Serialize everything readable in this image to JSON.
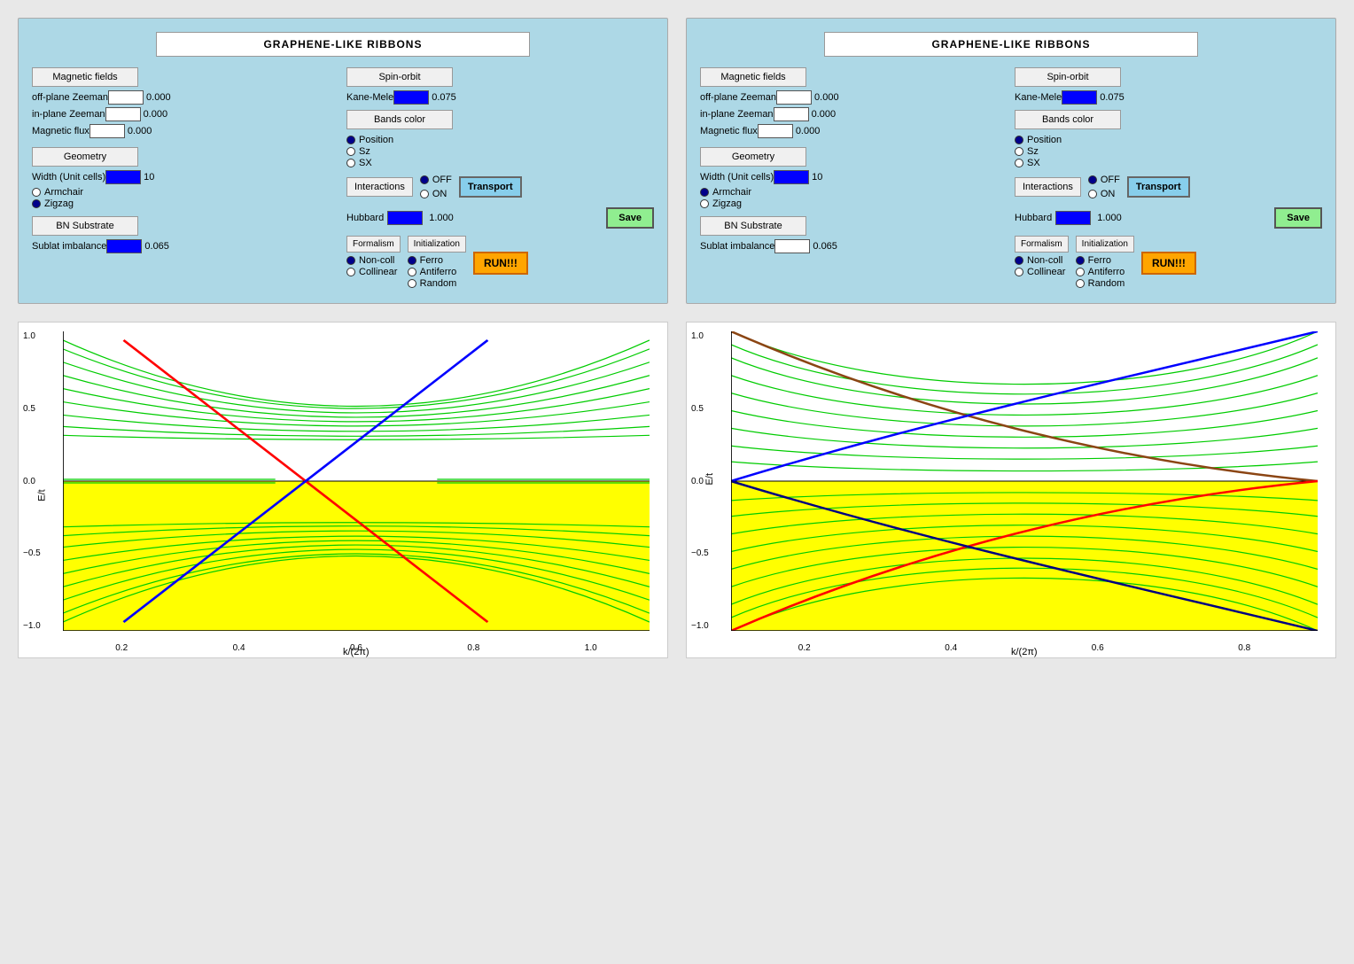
{
  "panels": [
    {
      "id": "panel-left",
      "title": "GRAPHENE-LIKE RIBBONS",
      "magnetic_fields": {
        "label": "Magnetic fields",
        "off_plane_zeeman": {
          "label": "off-plane Zeeman",
          "value": "0.000"
        },
        "in_plane_zeeman": {
          "label": "in-plane Zeeman",
          "value": "0.000"
        },
        "magnetic_flux": {
          "label": "Magnetic flux",
          "value": "0.000"
        }
      },
      "spin_orbit": {
        "label": "Spin-orbit",
        "kane_mele": {
          "label": "Kane-Mele",
          "value": "0.075"
        }
      },
      "bands_color": {
        "label": "Bands color",
        "options": [
          "Position",
          "Sz",
          "SX"
        ],
        "selected": "Position"
      },
      "geometry": {
        "label": "Geometry",
        "width_label": "Width (Unit cells)",
        "width_value": "10",
        "edge_options": [
          "Armchair",
          "Zigzag"
        ],
        "edge_selected": "Zigzag"
      },
      "interactions": {
        "label": "Interactions",
        "off_label": "OFF",
        "on_label": "ON",
        "selected": "OFF",
        "hubbard_label": "Hubbard",
        "hubbard_value": "1.000"
      },
      "bn_substrate": {
        "label": "BN Substrate",
        "sublat_label": "Sublat imbalance",
        "sublat_value": "0.065"
      },
      "formalism": {
        "label": "Formalism",
        "options": [
          "Non-coll",
          "Collinear"
        ],
        "selected": "Non-coll"
      },
      "initialization": {
        "label": "Initialization",
        "options": [
          "Ferro",
          "Antiferro",
          "Random"
        ],
        "selected": "Ferro"
      },
      "transport_label": "Transport",
      "save_label": "Save",
      "run_label": "RUN!!!"
    },
    {
      "id": "panel-right",
      "title": "GRAPHENE-LIKE RIBBONS",
      "magnetic_fields": {
        "label": "Magnetic fields",
        "off_plane_zeeman": {
          "label": "off-plane Zeeman",
          "value": "0.000"
        },
        "in_plane_zeeman": {
          "label": "in-plane Zeeman",
          "value": "0.000"
        },
        "magnetic_flux": {
          "label": "Magnetic flux",
          "value": "0.000"
        }
      },
      "spin_orbit": {
        "label": "Spin-orbit",
        "kane_mele": {
          "label": "Kane-Mele",
          "value": "0.075"
        }
      },
      "bands_color": {
        "label": "Bands color",
        "options": [
          "Position",
          "Sz",
          "SX"
        ],
        "selected": "Position"
      },
      "geometry": {
        "label": "Geometry",
        "width_label": "Width (Unit cells)",
        "width_value": "10",
        "edge_options": [
          "Armchair",
          "Zigzag"
        ],
        "edge_selected": "Armchair"
      },
      "interactions": {
        "label": "Interactions",
        "off_label": "OFF",
        "on_label": "ON",
        "selected": "OFF",
        "hubbard_label": "Hubbard",
        "hubbard_value": "1.000"
      },
      "bn_substrate": {
        "label": "BN Substrate",
        "sublat_label": "Sublat imbalance",
        "sublat_value": "0.065"
      },
      "formalism": {
        "label": "Formalism",
        "options": [
          "Non-coll",
          "Collinear"
        ],
        "selected": "Non-coll"
      },
      "initialization": {
        "label": "Initialization",
        "options": [
          "Ferro",
          "Antiferro",
          "Random"
        ],
        "selected": "Ferro"
      },
      "transport_label": "Transport",
      "save_label": "Save",
      "run_label": "RUN!!!"
    }
  ],
  "chart1": {
    "x_label": "k/(2π)",
    "y_label": "E/t",
    "x_ticks": [
      "0.2",
      "0.4",
      "0.6",
      "0.8",
      "1.0"
    ],
    "y_ticks": [
      "-1.0",
      "-0.5",
      "0.0",
      "0.5",
      "1.0"
    ]
  },
  "chart2": {
    "x_label": "k/(2π)",
    "y_label": "E/t",
    "x_ticks": [
      "0.2",
      "0.4",
      "0.6",
      "0.8"
    ],
    "y_ticks": [
      "-1.0",
      "-0.5",
      "0.0",
      "0.5",
      "1.0"
    ]
  }
}
